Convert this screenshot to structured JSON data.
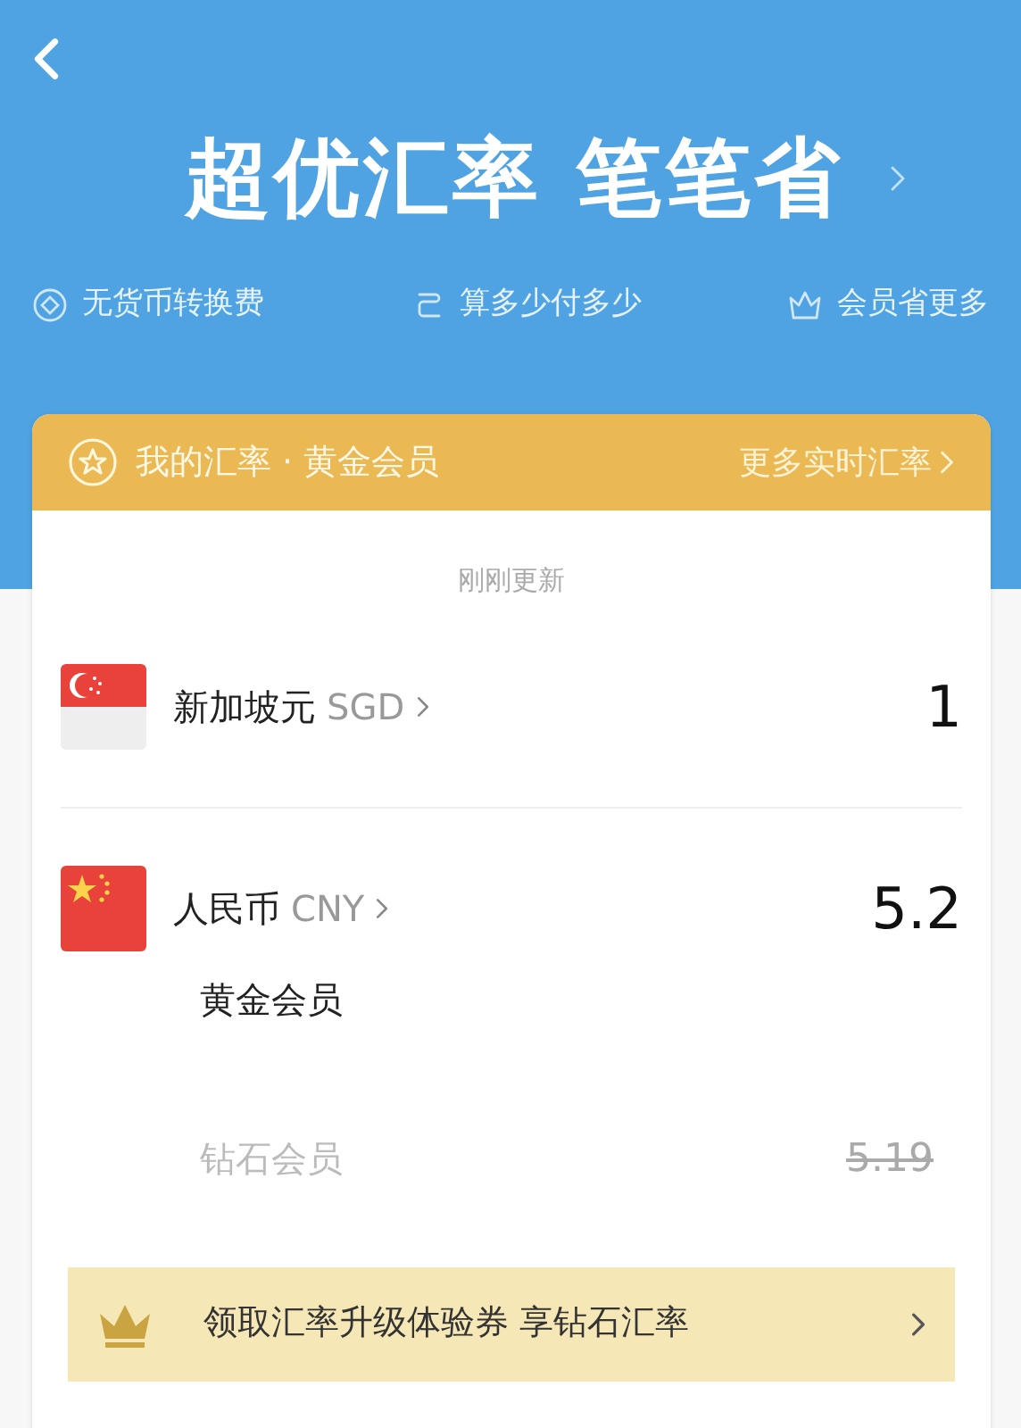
{
  "header": {
    "title": "超优汇率 笔笔省",
    "features": [
      {
        "kind": "coin",
        "label": "无货币转换费"
      },
      {
        "kind": "swap",
        "label": "算多少付多少"
      },
      {
        "kind": "crown",
        "label": "会员省更多"
      }
    ]
  },
  "card": {
    "title": "我的汇率 · 黄金会员",
    "more_link": "更多实时汇率",
    "updated": "刚刚更新",
    "currencies": [
      {
        "kind": "sg",
        "name": "新加坡元",
        "code": "SGD",
        "amount": "1"
      },
      {
        "kind": "cn",
        "name": "人民币",
        "code": "CNY",
        "amount": "5.2",
        "tiers": [
          {
            "label": "黄金会员",
            "kind": "current"
          },
          {
            "label": "钻石会员",
            "kind": "struck",
            "value": "5.19"
          }
        ]
      }
    ],
    "promo": "领取汇率升级体验券 享钻石汇率"
  }
}
